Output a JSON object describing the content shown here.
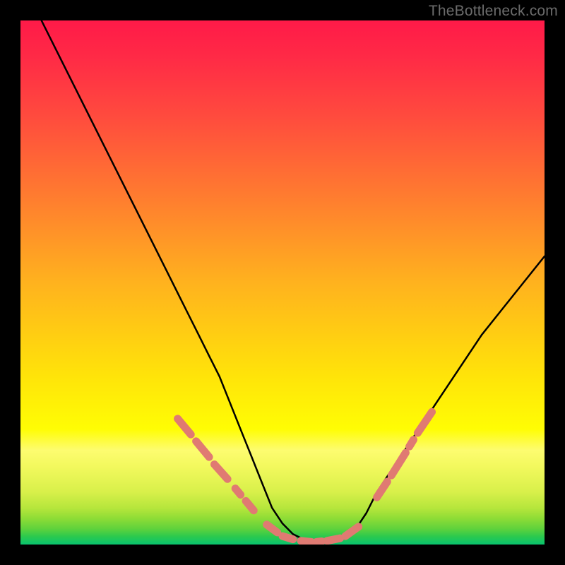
{
  "watermark": "TheBottleneck.com",
  "chart_data": {
    "type": "line",
    "title": "",
    "xlabel": "",
    "ylabel": "",
    "xlim": [
      0,
      100
    ],
    "ylim": [
      0,
      100
    ],
    "grid": false,
    "legend": false,
    "series": [
      {
        "name": "bottleneck-curve",
        "color": "#000000",
        "x": [
          4,
          8,
          12,
          16,
          20,
          24,
          28,
          32,
          34,
          36,
          38,
          40,
          42,
          44,
          46,
          48,
          50,
          52,
          54,
          56,
          58,
          60,
          62,
          64,
          66,
          68,
          72,
          76,
          80,
          84,
          88,
          92,
          96,
          100
        ],
        "y": [
          100,
          92,
          84,
          76,
          68,
          60,
          52,
          44,
          40,
          36,
          32,
          27,
          22,
          17,
          12,
          7,
          4,
          2,
          1,
          0.5,
          0.5,
          0.8,
          1.5,
          3,
          6,
          10,
          16,
          22,
          28,
          34,
          40,
          45,
          50,
          55
        ]
      },
      {
        "name": "highlight-dashes-left",
        "color": "#e07a72",
        "segments": [
          {
            "x": [
              30,
              32.5
            ],
            "y": [
              24,
              21
            ]
          },
          {
            "x": [
              33.5,
              36
            ],
            "y": [
              19.7,
              16.7
            ]
          },
          {
            "x": [
              37,
              39.5
            ],
            "y": [
              15.3,
              12.5
            ]
          },
          {
            "x": [
              41,
              42
            ],
            "y": [
              10.7,
              9.5
            ]
          },
          {
            "x": [
              43,
              44.5
            ],
            "y": [
              8.3,
              6.5
            ]
          },
          {
            "x": [
              47,
              49
            ],
            "y": [
              3.8,
              2.3
            ]
          }
        ]
      },
      {
        "name": "highlight-dashes-bottom",
        "color": "#e07a72",
        "segments": [
          {
            "x": [
              50,
              52
            ],
            "y": [
              1.6,
              1.0
            ]
          },
          {
            "x": [
              53.5,
              55.5
            ],
            "y": [
              0.7,
              0.5
            ]
          },
          {
            "x": [
              56.5,
              57.5
            ],
            "y": [
              0.5,
              0.6
            ]
          },
          {
            "x": [
              58.5,
              61
            ],
            "y": [
              0.7,
              1.2
            ]
          },
          {
            "x": [
              62,
              64.5
            ],
            "y": [
              1.6,
              3.4
            ]
          }
        ]
      },
      {
        "name": "highlight-dashes-right",
        "color": "#e07a72",
        "segments": [
          {
            "x": [
              68,
              70
            ],
            "y": [
              9,
              12
            ]
          },
          {
            "x": [
              70.8,
              73.5
            ],
            "y": [
              13.2,
              17.5
            ]
          },
          {
            "x": [
              74.2,
              75
            ],
            "y": [
              18.7,
              20
            ]
          },
          {
            "x": [
              75.8,
              78.5
            ],
            "y": [
              21.3,
              25.3
            ]
          }
        ]
      }
    ],
    "background_gradient_stops": [
      {
        "pos": 0.0,
        "color": "#ff1a48"
      },
      {
        "pos": 0.18,
        "color": "#ff4a3e"
      },
      {
        "pos": 0.5,
        "color": "#ffb21e"
      },
      {
        "pos": 0.78,
        "color": "#fffd04"
      },
      {
        "pos": 0.93,
        "color": "#b6e63c"
      },
      {
        "pos": 1.0,
        "color": "#08c36f"
      }
    ]
  }
}
